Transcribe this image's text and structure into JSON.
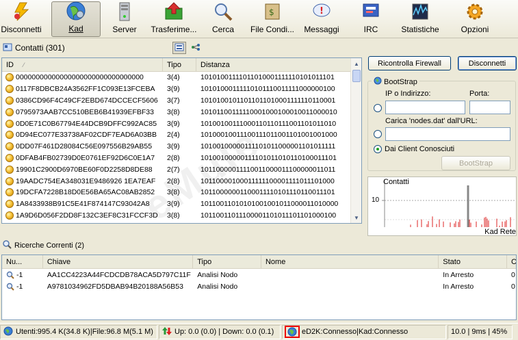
{
  "toolbar": {
    "items": [
      {
        "label": "Disconnetti",
        "icon": "lightning-disconnect-icon"
      },
      {
        "label": "Kad",
        "icon": "kad-globe-icon",
        "active": true
      },
      {
        "label": "Server",
        "icon": "server-icon"
      },
      {
        "label": "Trasferime...",
        "icon": "transfer-folder-icon"
      },
      {
        "label": "Cerca",
        "icon": "search-magnifier-icon"
      },
      {
        "label": "File Condi...",
        "icon": "shared-files-icon"
      },
      {
        "label": "Messaggi",
        "icon": "messages-icon"
      },
      {
        "label": "IRC",
        "icon": "irc-icon"
      },
      {
        "label": "Statistiche",
        "icon": "statistics-icon"
      },
      {
        "label": "Opzioni",
        "icon": "options-gear-icon"
      }
    ]
  },
  "contacts": {
    "title": "Contatti (301)",
    "columns": {
      "id": "ID",
      "tipo": "Tipo",
      "distanza": "Distanza"
    },
    "rows": [
      {
        "id": "00000000000000000000000000000000",
        "tipo": "3(4)",
        "dist": "10101001111011010001111110101011101"
      },
      {
        "id": "0117F8DBCB24A3562FF1C093E13FCEBA",
        "tipo": "3(9)",
        "dist": "10101000111110101110011111000000100"
      },
      {
        "id": "0386CD96F4C49CF2EBD674DCCECF5606",
        "tipo": "3(7)",
        "dist": "10101001011011011010001111110110001"
      },
      {
        "id": "0795973AAB7CC510BEB6B41939EFBF33",
        "tipo": "3(8)",
        "dist": "10101100111110001000100010011000010"
      },
      {
        "id": "0D0E71C0B67794E44DCB9DFFC992AC85",
        "tipo": "3(9)",
        "dist": "10100100111000110110111001101011010"
      },
      {
        "id": "0D94EC077E33738AF02CDF7EAD6A03BB",
        "tipo": "2(4)",
        "dist": "10100010011100111011001101001001000"
      },
      {
        "id": "0DD07F461D28084C56E097556B29AB55",
        "tipo": "3(9)",
        "dist": "10100100000111101011000001101011111"
      },
      {
        "id": "0DFAB4FB02739D0E0761EF92D6C0E1A7",
        "tipo": "2(8)",
        "dist": "10100100000111101011010110100011101"
      },
      {
        "id": "19901C2900D6970BE60F0D2258D8DE88",
        "tipo": "2(7)",
        "dist": "10110000011110011000011100000011011"
      },
      {
        "id": "19AADC754EA348031E9486926 1EA7EAF",
        "tipo": "2(8)",
        "dist": "10110000100011111100001111011101000"
      },
      {
        "id": "19DCFA7228B18D0E56BA65AC08AB2852",
        "tipo": "3(8)",
        "dist": "10110000001100011110101110110011101"
      },
      {
        "id": "1A8433938B91C5E41F874147C93042A8",
        "tipo": "3(9)",
        "dist": "10110011010101001001011000011010000"
      },
      {
        "id": "1A9D6D056F2DD8F132C3EF8C31FCCF3D",
        "tipo": "3(8)",
        "dist": "10110011011100001101011101101000100"
      }
    ]
  },
  "firewall_button": "Ricontrolla Firewall",
  "disconnect_button": "Disconnetti",
  "bootstrap": {
    "title": "BootStrap",
    "ip_label": "IP o Indirizzo:",
    "port_label": "Porta:",
    "url_label": "Carica 'nodes.dat' dall'URL:",
    "known_clients_label": "Dai Client Conosciuti",
    "button": "BootStrap",
    "ip_value": "",
    "port_value": "",
    "url_value": ""
  },
  "graph": {
    "title": "Contatti",
    "tick_label": "10",
    "footer": "Kad Rete"
  },
  "searches": {
    "title": "Ricerche Correnti (2)",
    "columns": {
      "num": "Nu...",
      "chiave": "Chiave",
      "tipo": "Tipo",
      "nome": "Nome",
      "stato": "Stato",
      "extra": "C"
    },
    "rows": [
      {
        "num": "-1",
        "chiave": "AA1CC4223A44FCDCDB78ACA5D797C11F",
        "tipo": "Analisi Nodo",
        "nome": "",
        "stato": "In Arresto",
        "extra": "0"
      },
      {
        "num": "-1",
        "chiave": "A9781034962FD5DBAB94B20188A56B53",
        "tipo": "Analisi Nodo",
        "nome": "",
        "stato": "In Arresto",
        "extra": "0"
      }
    ]
  },
  "statusbar": {
    "users": "Utenti:995.4 K(34.8 K)|File:96.8 M(5.1 M)",
    "transfer": "Up: 0.0 (0.0) | Down: 0.0 (0.1)",
    "network": "eD2K:Connesso|Kad:Connesso",
    "ping": "10.0 | 9ms | 45%"
  }
}
